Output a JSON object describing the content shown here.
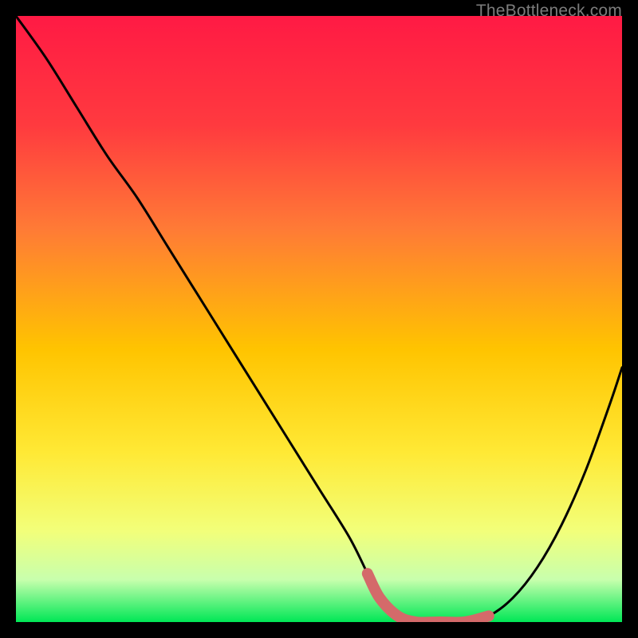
{
  "watermark": "TheBottleneck.com",
  "colors": {
    "bg": "#000000",
    "curve": "#000000",
    "highlight": "#d46a6a",
    "gradient_top": "#ff1a44",
    "gradient_mid_upper": "#ff6a3a",
    "gradient_mid": "#ffd200",
    "gradient_mid_lower": "#f6ff60",
    "gradient_low": "#dfffb0",
    "gradient_bottom": "#00e756"
  },
  "chart_data": {
    "type": "line",
    "title": "",
    "xlabel": "",
    "ylabel": "",
    "xlim": [
      0,
      100
    ],
    "ylim": [
      0,
      100
    ],
    "x": [
      0,
      5,
      10,
      15,
      20,
      25,
      30,
      35,
      40,
      45,
      50,
      55,
      58,
      60,
      63,
      66,
      70,
      74,
      78,
      82,
      86,
      90,
      94,
      98,
      100
    ],
    "series": [
      {
        "name": "bottleneck-curve",
        "values": [
          100,
          93,
          85,
          77,
          70,
          62,
          54,
          46,
          38,
          30,
          22,
          14,
          8,
          4,
          1,
          0,
          0,
          0,
          1,
          4,
          9,
          16,
          25,
          36,
          42
        ]
      }
    ],
    "highlight_region": {
      "x_start": 58,
      "x_end": 80,
      "description": "flat valley / optimal zone marked in salmon"
    }
  }
}
